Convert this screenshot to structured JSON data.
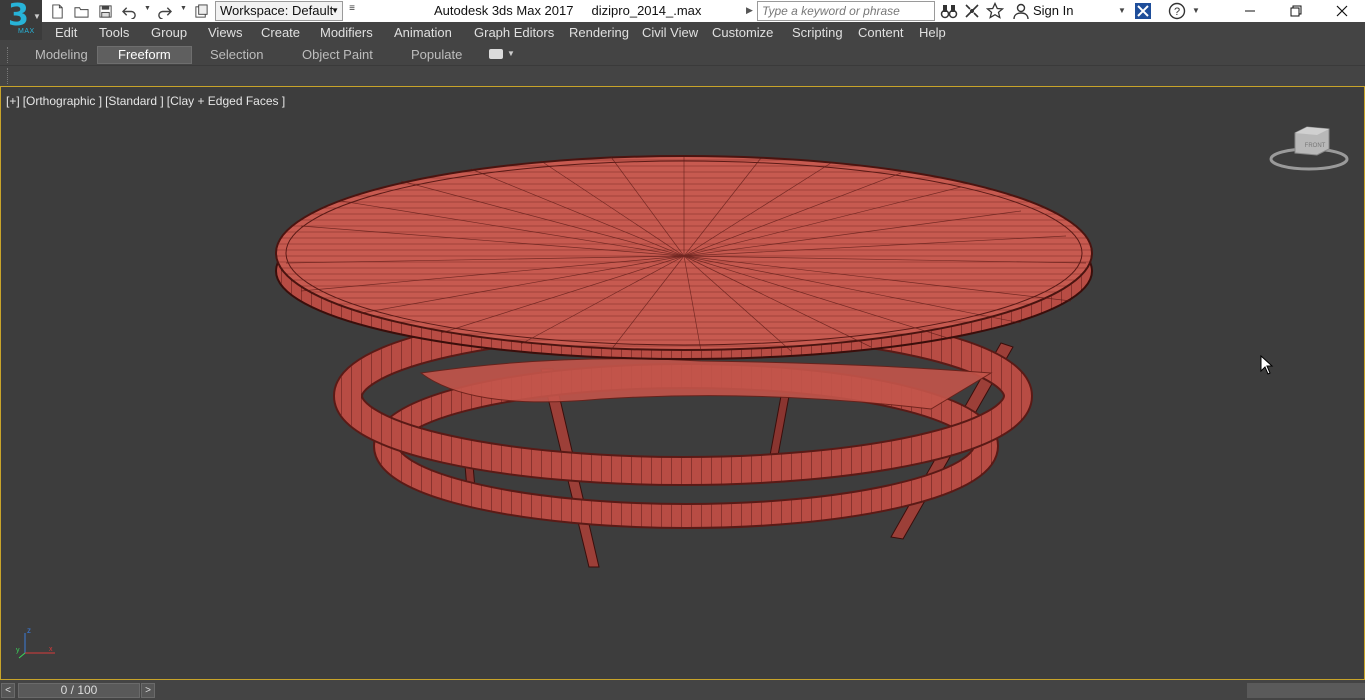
{
  "titlebar": {
    "app_name": "Autodesk 3ds Max 2017",
    "file_name": "dizipro_2014_.max",
    "logo_number": "3",
    "logo_text": "MAX",
    "workspace_label": "Workspace: Default",
    "search_placeholder": "Type a keyword or phrase",
    "sign_in_label": "Sign In",
    "icons": [
      "new-file-icon",
      "open-folder-icon",
      "save-icon",
      "undo-icon",
      "redo-icon",
      "project-folder-icon",
      "binoculars-icon",
      "satellite-icon",
      "star-icon",
      "user-icon",
      "exchange-icon",
      "help-icon"
    ]
  },
  "menu": {
    "items": [
      "Edit",
      "Tools",
      "Group",
      "Views",
      "Create",
      "Modifiers",
      "Animation",
      "Graph Editors",
      "Rendering",
      "Civil View",
      "Customize",
      "Scripting",
      "Content",
      "Help"
    ]
  },
  "ribbon": {
    "tabs": [
      "Modeling",
      "Freeform",
      "Selection",
      "Object Paint",
      "Populate"
    ],
    "active_tab": "Freeform"
  },
  "viewport": {
    "label_parts": [
      "[+]",
      "[Orthographic ]",
      "[Standard ]",
      "[Clay + Edged Faces ]"
    ],
    "viewcube_face": "FRONT",
    "axis_labels": [
      "z",
      "x",
      "y"
    ],
    "model_color": "#c8544a",
    "border_color": "#c8a42a"
  },
  "timeline": {
    "frame_readout": "0 / 100",
    "prev_label": "<",
    "next_label": ">"
  }
}
